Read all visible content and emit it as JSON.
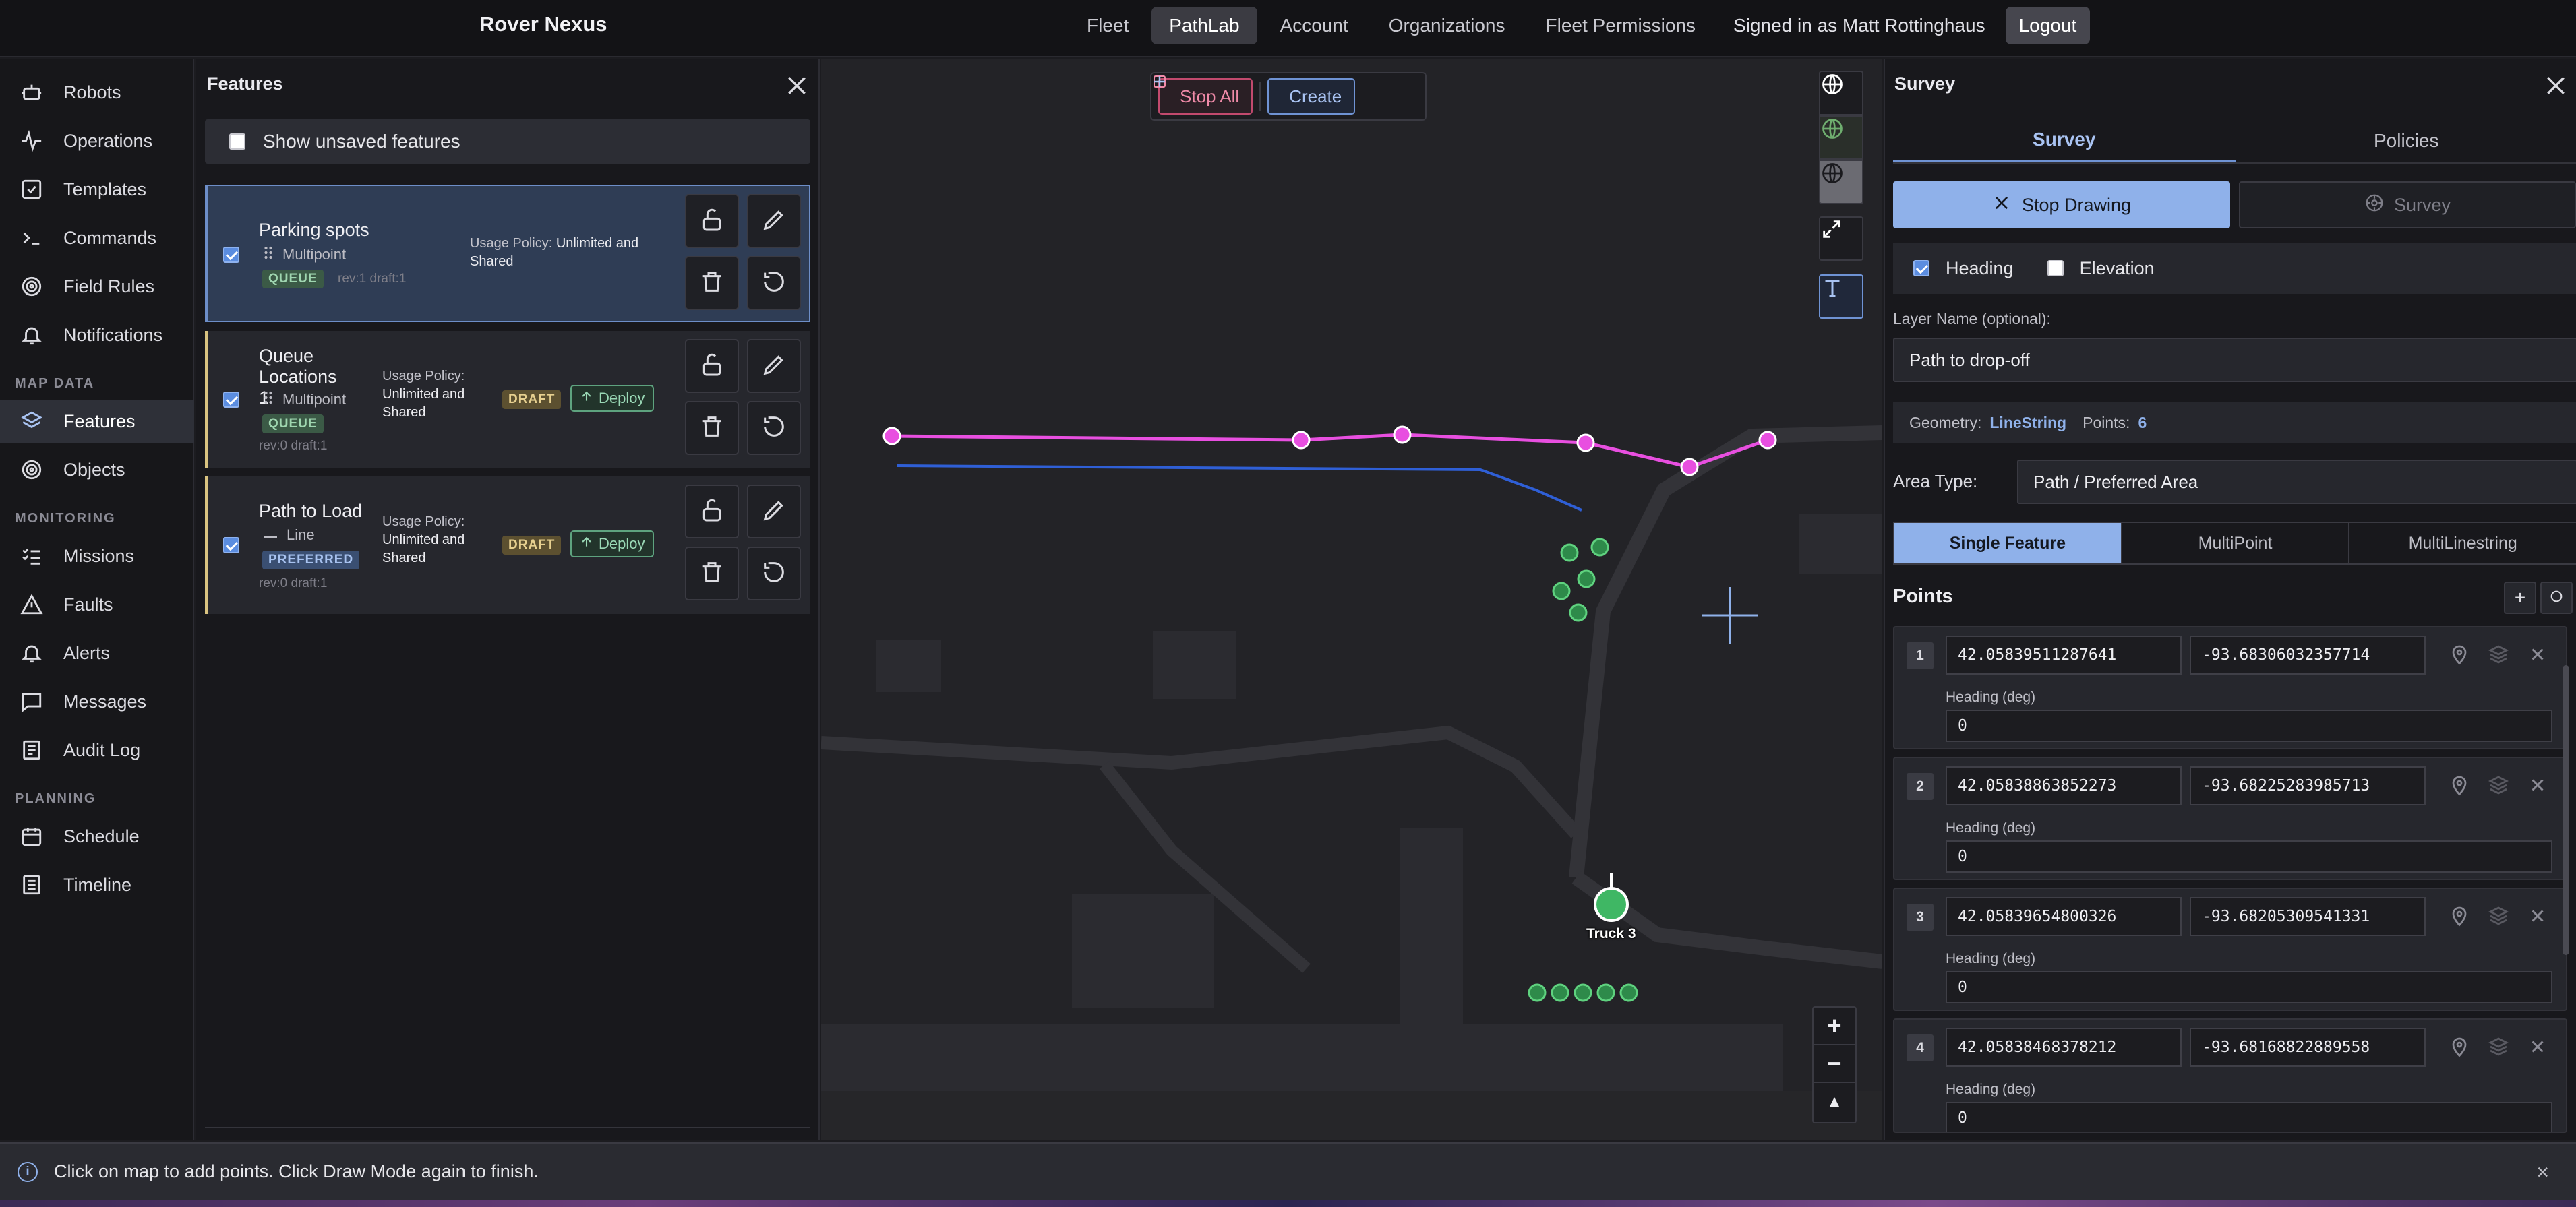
{
  "app": {
    "brand": "Rover Nexus"
  },
  "nav": {
    "items": [
      "Fleet",
      "PathLab",
      "Account",
      "Organizations",
      "Fleet Permissions"
    ],
    "active": "PathLab",
    "signed_in": "Signed in as Matt Rottinghaus",
    "logout": "Logout"
  },
  "sidebar": {
    "items": [
      {
        "label": "Robots",
        "icon": "robot-icon"
      },
      {
        "label": "Operations",
        "icon": "activity-icon"
      },
      {
        "label": "Templates",
        "icon": "checkbox-icon"
      },
      {
        "label": "Commands",
        "icon": "terminal-icon"
      },
      {
        "label": "Field Rules",
        "icon": "target-icon"
      },
      {
        "label": "Notifications",
        "icon": "bell-icon"
      }
    ],
    "map_data_heading": "MAP DATA",
    "map_data_items": [
      {
        "label": "Features",
        "icon": "layers-icon",
        "active": true
      },
      {
        "label": "Objects",
        "icon": "target-icon"
      }
    ],
    "monitoring_heading": "MONITORING",
    "monitoring_items": [
      {
        "label": "Missions",
        "icon": "list-check-icon"
      },
      {
        "label": "Faults",
        "icon": "warning-icon"
      },
      {
        "label": "Alerts",
        "icon": "bell-icon"
      },
      {
        "label": "Messages",
        "icon": "message-icon"
      },
      {
        "label": "Audit Log",
        "icon": "log-icon"
      }
    ],
    "planning_heading": "PLANNING",
    "planning_items": [
      {
        "label": "Schedule",
        "icon": "calendar-icon"
      },
      {
        "label": "Timeline",
        "icon": "timeline-icon"
      }
    ]
  },
  "features": {
    "title": "Features",
    "show_unsaved": "Show unsaved features",
    "cards": [
      {
        "name": "Parking spots",
        "type": "Multipoint",
        "badge": "QUEUE",
        "rev": "rev:1 draft:1",
        "policy_label": "Usage Policy:",
        "policy_value": "Unlimited and Shared"
      },
      {
        "name": "Queue Locations 1",
        "type": "Multipoint",
        "badge": "QUEUE",
        "rev": "rev:0 draft:1",
        "policy_label": "Usage Policy:",
        "policy_value": "Unlimited and Shared",
        "status": "DRAFT",
        "deploy": "Deploy"
      },
      {
        "name": "Path to Load",
        "type": "Line",
        "badge": "PREFERRED",
        "rev": "rev:0 draft:1",
        "policy_label": "Usage Policy:",
        "policy_value": "Unlimited and Shared",
        "status": "DRAFT",
        "deploy": "Deploy"
      }
    ]
  },
  "map": {
    "stop_all": "Stop All",
    "create": "Create",
    "truck_label": "Truck 3",
    "colors": {
      "path": "#e84fe0",
      "route": "#2f5fd6",
      "marker": "#3fb764"
    }
  },
  "survey": {
    "title": "Survey",
    "tabs": [
      "Survey",
      "Policies"
    ],
    "stop_drawing": "Stop Drawing",
    "survey_button": "Survey",
    "heading_label": "Heading",
    "elevation_label": "Elevation",
    "layer_name_label": "Layer Name (optional):",
    "layer_name_value": "Path to drop-off",
    "geometry_label": "Geometry:",
    "geometry_value": "LineString",
    "points_label": "Points:",
    "points_value": "6",
    "area_type_label": "Area Type:",
    "area_type_value": "Path / Preferred Area",
    "modes": [
      "Single Feature",
      "MultiPoint",
      "MultiLinestring"
    ],
    "points_heading": "Points",
    "heading_deg_label": "Heading (deg)",
    "points": [
      {
        "n": "1",
        "lat": "42.05839511287641",
        "lon": "-93.68306032357714",
        "heading": "0"
      },
      {
        "n": "2",
        "lat": "42.05838863852273",
        "lon": "-93.68225283985713",
        "heading": "0"
      },
      {
        "n": "3",
        "lat": "42.05839654800326",
        "lon": "-93.68205309541331",
        "heading": "0"
      },
      {
        "n": "4",
        "lat": "42.05838468378212",
        "lon": "-93.68168822889558",
        "heading": "0"
      }
    ]
  },
  "status": {
    "message": "Click on map to add points. Click Draw Mode again to finish."
  }
}
